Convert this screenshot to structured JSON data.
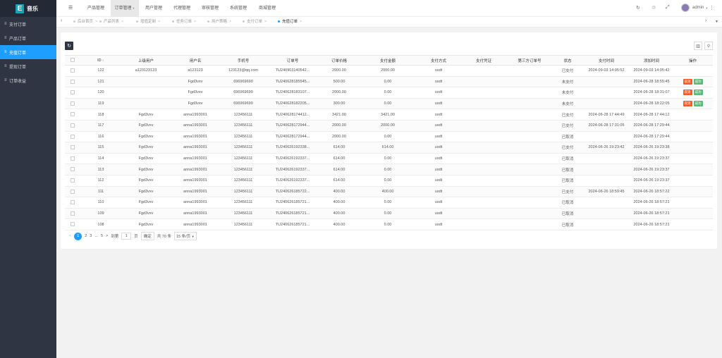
{
  "sidebar": {
    "logo_letter": "E",
    "logo_text": "音乐",
    "items": [
      {
        "label": "支付订单",
        "icon": "list-icon"
      },
      {
        "label": "产品订单",
        "icon": "list-icon"
      },
      {
        "label": "充值订单",
        "icon": "list-icon",
        "active": true
      },
      {
        "label": "提现订单",
        "icon": "list-icon"
      },
      {
        "label": "订单收益",
        "icon": "list-icon"
      }
    ]
  },
  "header": {
    "menu_toggle": "☰",
    "nav": [
      {
        "label": "产品管理"
      },
      {
        "label": "订单管理",
        "active": true
      },
      {
        "label": "用户管理"
      },
      {
        "label": "代理管理"
      },
      {
        "label": "审核管理"
      },
      {
        "label": "系统管理"
      },
      {
        "label": "商城管理"
      }
    ],
    "user_name": "admin"
  },
  "tabs": [
    {
      "label": "后台首页"
    },
    {
      "label": "产品列表"
    },
    {
      "label": "增值定制"
    },
    {
      "label": "任务订单"
    },
    {
      "label": "用户策略"
    },
    {
      "label": "支付订单"
    },
    {
      "label": "充值订单",
      "active": true
    }
  ],
  "table": {
    "headers": [
      "ID",
      "上级用户",
      "用户名",
      "手机号",
      "订单号",
      "订单价格",
      "支付金额",
      "支付方式",
      "支付凭证",
      "第三方订单号",
      "状态",
      "支付时间",
      "添加时间",
      "操作"
    ],
    "rows": [
      {
        "id": "122",
        "parent": "a123123123",
        "username": "a123123",
        "phone": "123123@qq.com",
        "order_no": "TU240903140542...",
        "price": "2000.00",
        "paid": "2000.00",
        "method": "usdt",
        "voucher": "",
        "third": "",
        "status": "已支付",
        "pay_time": "2024-09-03 14:05:52",
        "add_time": "2024-09-03 14:05:42",
        "actions": false
      },
      {
        "id": "121",
        "parent": "",
        "username": "Fgd3vxv",
        "phone": "696969690",
        "order_no": "TU240628185545...",
        "price": "500.00",
        "paid": "0.00",
        "method": "usdt",
        "voucher": "",
        "third": "",
        "status": "未支付",
        "pay_time": "",
        "add_time": "2024-06-28 18:55:45",
        "actions": true
      },
      {
        "id": "120",
        "parent": "",
        "username": "Fgd3vxv",
        "phone": "696969690",
        "order_no": "TU240628183107...",
        "price": "2000.00",
        "paid": "0.00",
        "method": "usdt",
        "voucher": "",
        "third": "",
        "status": "未支付",
        "pay_time": "",
        "add_time": "2024-06-28 18:31:07",
        "actions": true
      },
      {
        "id": "119",
        "parent": "",
        "username": "Fgd3vxv",
        "phone": "696969690",
        "order_no": "TU240628182205...",
        "price": "300.00",
        "paid": "0.00",
        "method": "usdt",
        "voucher": "",
        "third": "",
        "status": "未支付",
        "pay_time": "",
        "add_time": "2024-06-28 18:22:05",
        "actions": true
      },
      {
        "id": "118",
        "parent": "Fgd3vxv",
        "username": "anna1993001",
        "phone": "123456111",
        "order_no": "TU240628174412...",
        "price": "3421.00",
        "paid": "3421.00",
        "method": "usdt",
        "voucher": "",
        "third": "",
        "status": "已支付",
        "pay_time": "2024-06-28 17:44:49",
        "add_time": "2024-06-28 17:44:12",
        "actions": false
      },
      {
        "id": "117",
        "parent": "Fgd3vxv",
        "username": "anna1993001",
        "phone": "123456111",
        "order_no": "TU240628172944...",
        "price": "2000.00",
        "paid": "2000.00",
        "method": "usdt",
        "voucher": "",
        "third": "",
        "status": "已支付",
        "pay_time": "2024-06-28 17:31:05",
        "add_time": "2024-06-28 17:29:44",
        "actions": false
      },
      {
        "id": "116",
        "parent": "Fgd3vxv",
        "username": "anna1993001",
        "phone": "123456111",
        "order_no": "TU240628172944...",
        "price": "2000.00",
        "paid": "0.00",
        "method": "usdt",
        "voucher": "",
        "third": "",
        "status": "已取消",
        "pay_time": "",
        "add_time": "2024-06-28 17:29:44",
        "actions": false
      },
      {
        "id": "115",
        "parent": "Fgd3vxv",
        "username": "anna1993001",
        "phone": "123456111",
        "order_no": "TU240626192338...",
        "price": "614.00",
        "paid": "614.00",
        "method": "usdt",
        "voucher": "",
        "third": "",
        "status": "已支付",
        "pay_time": "2024-06-26 19:23:42",
        "add_time": "2024-06-26 19:23:38",
        "actions": false
      },
      {
        "id": "114",
        "parent": "Fgd3vxv",
        "username": "anna1993001",
        "phone": "123456111",
        "order_no": "TU240626192337...",
        "price": "614.00",
        "paid": "0.00",
        "method": "usdt",
        "voucher": "",
        "third": "",
        "status": "已取消",
        "pay_time": "",
        "add_time": "2024-06-26 19:23:37",
        "actions": false
      },
      {
        "id": "113",
        "parent": "Fgd3vxv",
        "username": "anna1993001",
        "phone": "123456111",
        "order_no": "TU240626192337...",
        "price": "614.00",
        "paid": "0.00",
        "method": "usdt",
        "voucher": "",
        "third": "",
        "status": "已取消",
        "pay_time": "",
        "add_time": "2024-06-26 19:23:37",
        "actions": false
      },
      {
        "id": "112",
        "parent": "Fgd3vxv",
        "username": "anna1993001",
        "phone": "123456111",
        "order_no": "TU240626192337...",
        "price": "614.00",
        "paid": "0.00",
        "method": "usdt",
        "voucher": "",
        "third": "",
        "status": "已取消",
        "pay_time": "",
        "add_time": "2024-06-26 19:23:37",
        "actions": false
      },
      {
        "id": "111",
        "parent": "Fgd3vxv",
        "username": "anna1993001",
        "phone": "123456111",
        "order_no": "TU240626185722...",
        "price": "400.00",
        "paid": "400.00",
        "method": "usdt",
        "voucher": "",
        "third": "",
        "status": "已支付",
        "pay_time": "2024-06-26 18:59:45",
        "add_time": "2024-06-26 18:57:22",
        "actions": false
      },
      {
        "id": "110",
        "parent": "Fgd3vxv",
        "username": "anna1993001",
        "phone": "123456111",
        "order_no": "TU240626185721...",
        "price": "400.00",
        "paid": "0.00",
        "method": "usdt",
        "voucher": "",
        "third": "",
        "status": "已取消",
        "pay_time": "",
        "add_time": "2024-06-26 18:57:21",
        "actions": false
      },
      {
        "id": "109",
        "parent": "Fgd3vxv",
        "username": "anna1993001",
        "phone": "123456111",
        "order_no": "TU240626185721...",
        "price": "400.00",
        "paid": "0.00",
        "method": "usdt",
        "voucher": "",
        "third": "",
        "status": "已取消",
        "pay_time": "",
        "add_time": "2024-06-26 18:57:21",
        "actions": false
      },
      {
        "id": "108",
        "parent": "Fgd3vxv",
        "username": "anna1993001",
        "phone": "123456111",
        "order_no": "TU240626185721...",
        "price": "400.00",
        "paid": "0.00",
        "method": "usdt",
        "voucher": "",
        "third": "",
        "status": "已取消",
        "pay_time": "",
        "add_time": "2024-06-26 18:57:21",
        "actions": false
      }
    ],
    "cancel_label": "取消",
    "ok_label": "成功"
  },
  "pager": {
    "prev": "<",
    "pages": [
      "1",
      "2",
      "3",
      "...",
      "5"
    ],
    "next": ">",
    "goto_label": "到第",
    "goto_value": "1",
    "page_suffix": "页",
    "confirm": "确定",
    "total": "共 70 条",
    "page_size": "15 条/页"
  },
  "colors": {
    "sidebar_bg": "#2f3542",
    "accent": "#1e9fff",
    "cancel": "#ff5722",
    "success": "#5fb878"
  }
}
